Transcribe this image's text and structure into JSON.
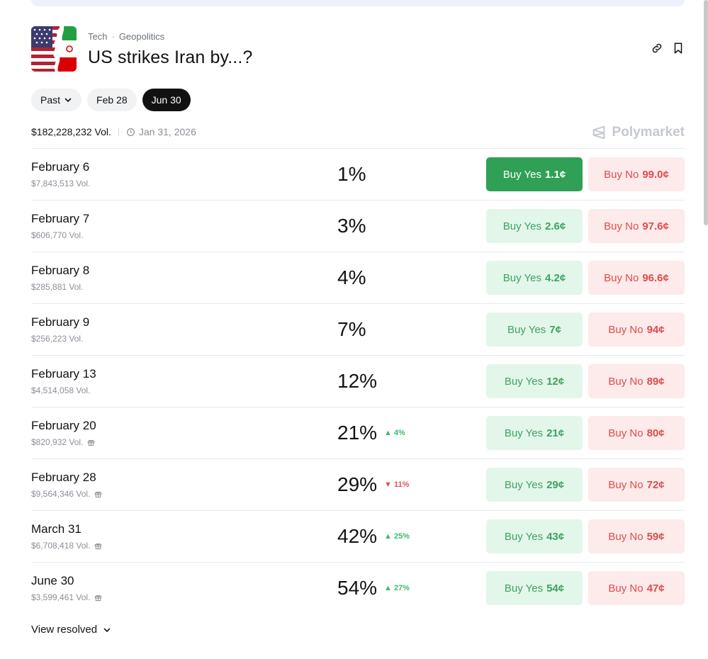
{
  "breadcrumbs": [
    "Tech",
    "Geopolitics"
  ],
  "title": "US strikes Iran by...?",
  "filters": [
    {
      "label": "Past",
      "dropdown": true,
      "active": false
    },
    {
      "label": "Feb 28",
      "dropdown": false,
      "active": false
    },
    {
      "label": "Jun 30",
      "dropdown": false,
      "active": true
    }
  ],
  "meta": {
    "volume": "$182,228,232 Vol.",
    "end_date": "Jan 31, 2026"
  },
  "brand": "Polymarket",
  "rows": [
    {
      "date": "February 6",
      "vol": "$7,843,513 Vol.",
      "gift": false,
      "pct": "1%",
      "delta": "",
      "yes_label": "Buy Yes",
      "yes_price": "1.1¢",
      "no_label": "Buy No",
      "no_price": "99.0¢"
    },
    {
      "date": "February 7",
      "vol": "$606,770 Vol.",
      "gift": false,
      "pct": "3%",
      "delta": "",
      "yes_label": "Buy Yes",
      "yes_price": "2.6¢",
      "no_label": "Buy No",
      "no_price": "97.6¢"
    },
    {
      "date": "February 8",
      "vol": "$285,881 Vol.",
      "gift": false,
      "pct": "4%",
      "delta": "",
      "yes_label": "Buy Yes",
      "yes_price": "4.2¢",
      "no_label": "Buy No",
      "no_price": "96.6¢"
    },
    {
      "date": "February 9",
      "vol": "$256,223 Vol.",
      "gift": false,
      "pct": "7%",
      "delta": "",
      "yes_label": "Buy Yes",
      "yes_price": "7¢",
      "no_label": "Buy No",
      "no_price": "94¢"
    },
    {
      "date": "February 13",
      "vol": "$4,514,058 Vol.",
      "gift": false,
      "pct": "12%",
      "delta": "",
      "yes_label": "Buy Yes",
      "yes_price": "12¢",
      "no_label": "Buy No",
      "no_price": "89¢"
    },
    {
      "date": "February 20",
      "vol": "$820,932 Vol.",
      "gift": true,
      "pct": "21%",
      "delta": "4%",
      "delta_dir": "up",
      "yes_label": "Buy Yes",
      "yes_price": "21¢",
      "no_label": "Buy No",
      "no_price": "80¢"
    },
    {
      "date": "February 28",
      "vol": "$9,564,346 Vol.",
      "gift": true,
      "pct": "29%",
      "delta": "11%",
      "delta_dir": "down",
      "yes_label": "Buy Yes",
      "yes_price": "29¢",
      "no_label": "Buy No",
      "no_price": "72¢"
    },
    {
      "date": "March 31",
      "vol": "$6,708,418 Vol.",
      "gift": true,
      "pct": "42%",
      "delta": "25%",
      "delta_dir": "up",
      "yes_label": "Buy Yes",
      "yes_price": "43¢",
      "no_label": "Buy No",
      "no_price": "59¢"
    },
    {
      "date": "June 30",
      "vol": "$3,599,461 Vol.",
      "gift": true,
      "pct": "54%",
      "delta": "27%",
      "delta_dir": "up",
      "yes_label": "Buy Yes",
      "yes_price": "54¢",
      "no_label": "Buy No",
      "no_price": "47¢"
    }
  ],
  "view_resolved": "View resolved",
  "colors": {
    "yes": "#3ea361",
    "yes_bg": "#e3f6ea",
    "yes_solid": "#2fa055",
    "no": "#e04b4b",
    "no_bg": "#fdeaea",
    "up": "#3dba6c",
    "down": "#e05252"
  },
  "icons": [
    "flag-thumbnail",
    "link-icon",
    "bookmark-icon",
    "chevron-down-icon",
    "clock-icon",
    "polymarket-logo-icon",
    "gift-icon",
    "triangle-up-icon",
    "triangle-down-icon"
  ]
}
